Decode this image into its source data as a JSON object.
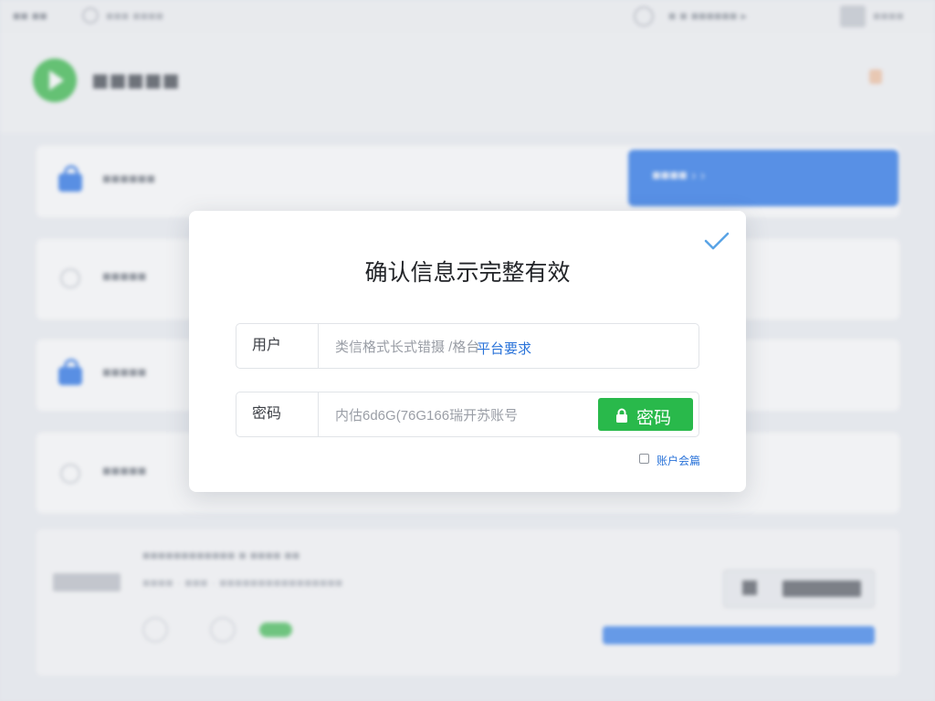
{
  "background": {
    "topbar": {
      "left_text": "■■ ■■",
      "left_text2": "■■■ ■■■■",
      "right_text": "■ ■ ■■■■■■ ▸",
      "right_text2": "■■■■"
    },
    "header": {
      "brand_title": "■■■■■"
    },
    "rows": [
      {
        "text": "■■■■■■"
      },
      {
        "text": "■■■■■"
      },
      {
        "text": "■■■■■"
      },
      {
        "text": "■■■■■"
      }
    ],
    "primary_button_label": "■■■■ › ›",
    "card_bottom": {
      "line1": "■■■■■■■■■■■■ ■ ■■■■ ■■",
      "line2": "■■■■ · ■■■ · ■■■■■■■■■■■■■■■■"
    }
  },
  "modal": {
    "title": "确认信息示完整有效",
    "username": {
      "label": "用户",
      "value": "类信格式长式错摄 /格台",
      "hint": "平台要求"
    },
    "password": {
      "label": "密码",
      "value": "内估6d6G(76G166瑞开苏账号",
      "button_label": "密码"
    },
    "remember_label": "账户会篇"
  },
  "colors": {
    "accent_blue": "#2b78ea",
    "success_green": "#29b94b",
    "check_color": "#5aa4e6",
    "link_blue": "#2a73d9"
  },
  "icons": {
    "close": "check-icon",
    "password_button": "lock-icon",
    "logo": "play-logo-icon"
  }
}
